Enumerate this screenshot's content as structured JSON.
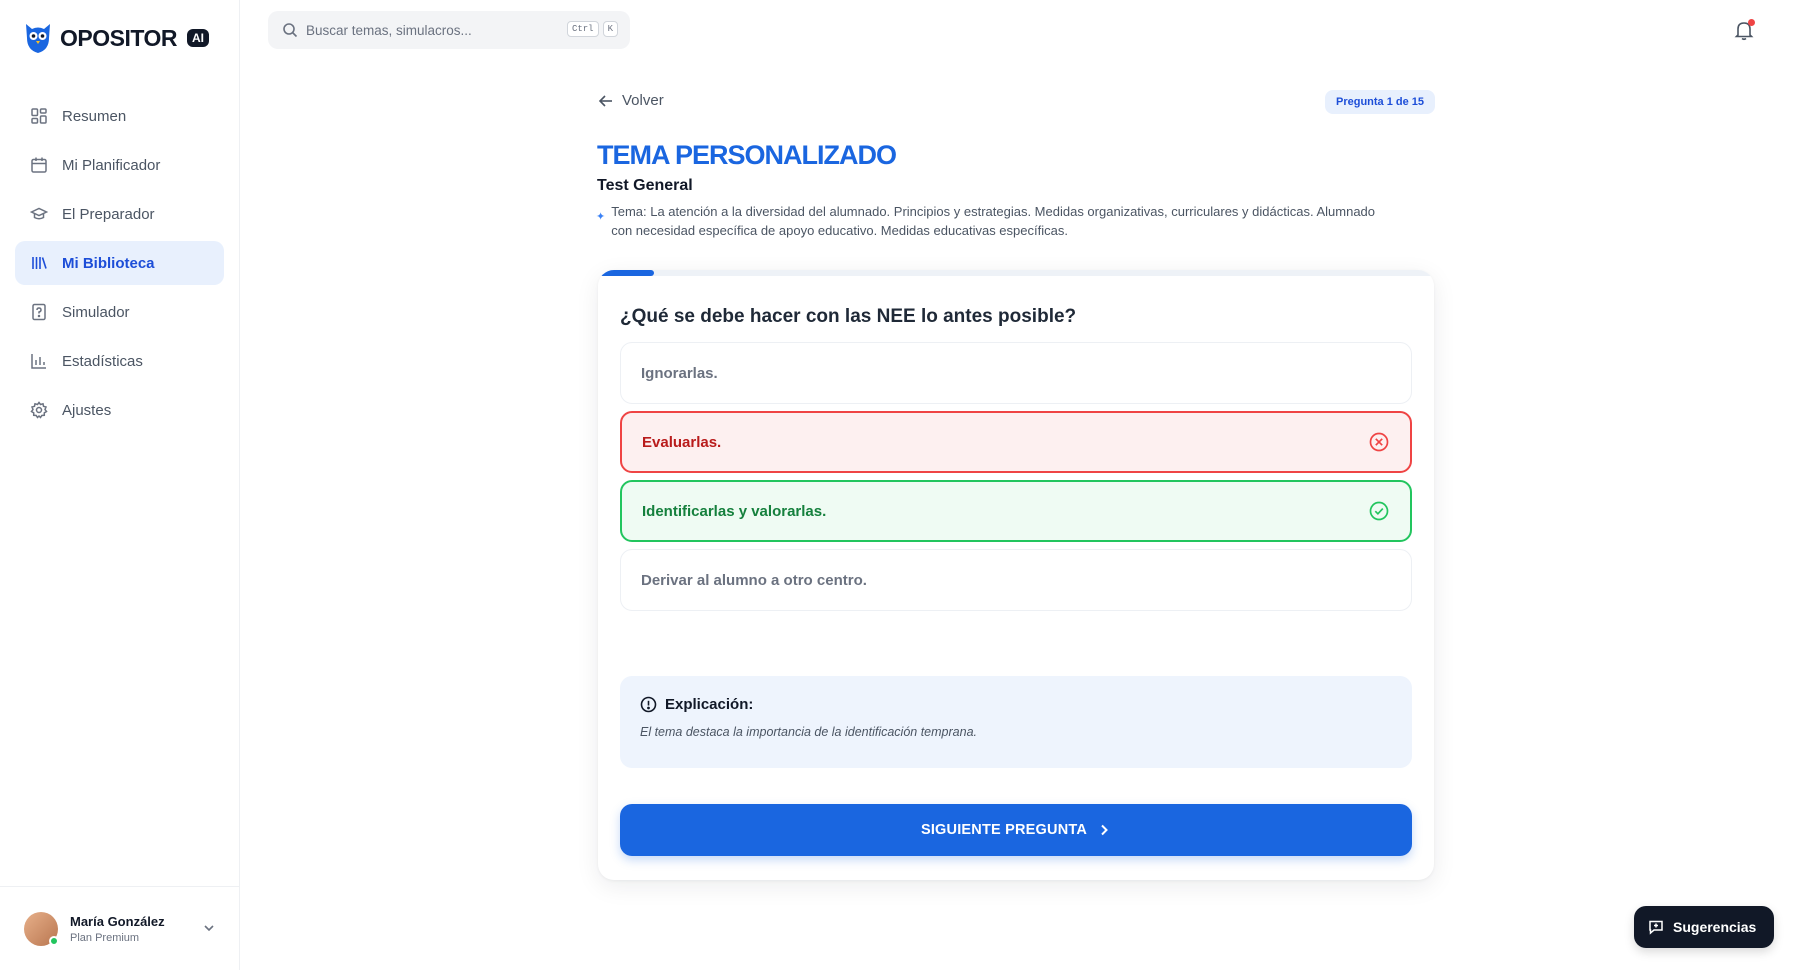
{
  "app": {
    "name": "OPOSITOR",
    "badge": "AI"
  },
  "search": {
    "placeholder": "Buscar temas, simulacros...",
    "shortcut_key1": "Ctrl",
    "shortcut_key2": "K"
  },
  "sidebar": {
    "items": [
      {
        "label": "Resumen",
        "icon": "grid-icon"
      },
      {
        "label": "Mi Planificador",
        "icon": "calendar-icon"
      },
      {
        "label": "El Preparador",
        "icon": "graduation-cap-icon"
      },
      {
        "label": "Mi Biblioteca",
        "icon": "library-icon",
        "active": true
      },
      {
        "label": "Simulador",
        "icon": "question-file-icon"
      },
      {
        "label": "Estadísticas",
        "icon": "bar-chart-icon"
      },
      {
        "label": "Ajustes",
        "icon": "gear-icon"
      }
    ]
  },
  "user": {
    "name": "María González",
    "plan": "Plan Premium"
  },
  "quiz": {
    "back_label": "Volver",
    "counter": "Pregunta 1 de 15",
    "progress": 0.0667,
    "title": "TEMA PERSONALIZADO",
    "subtitle": "Test General",
    "tema": "Tema: La atención a la diversidad del alumnado. Principios y estrategias. Medidas organizativas, curriculares y didácticas. Alumnado con necesidad específica de apoyo educativo. Medidas educativas específicas.",
    "question": "¿Qué se debe hacer con las NEE lo antes posible?",
    "options": [
      {
        "label": "Ignorarlas.",
        "state": "neutral"
      },
      {
        "label": "Evaluarlas.",
        "state": "wrong"
      },
      {
        "label": "Identificarlas y valorarlas.",
        "state": "correct"
      },
      {
        "label": "Derivar al alumno a otro centro.",
        "state": "neutral"
      }
    ],
    "explanation_title": "Explicación:",
    "explanation_text": "El tema destaca la importancia de la identificación temprana.",
    "next_label": "SIGUIENTE PREGUNTA"
  },
  "feedback_button": "Sugerencias",
  "colors": {
    "accent": "#1a66e0",
    "wrong": "#ef4444",
    "correct": "#22c55e",
    "dark": "#111827"
  }
}
